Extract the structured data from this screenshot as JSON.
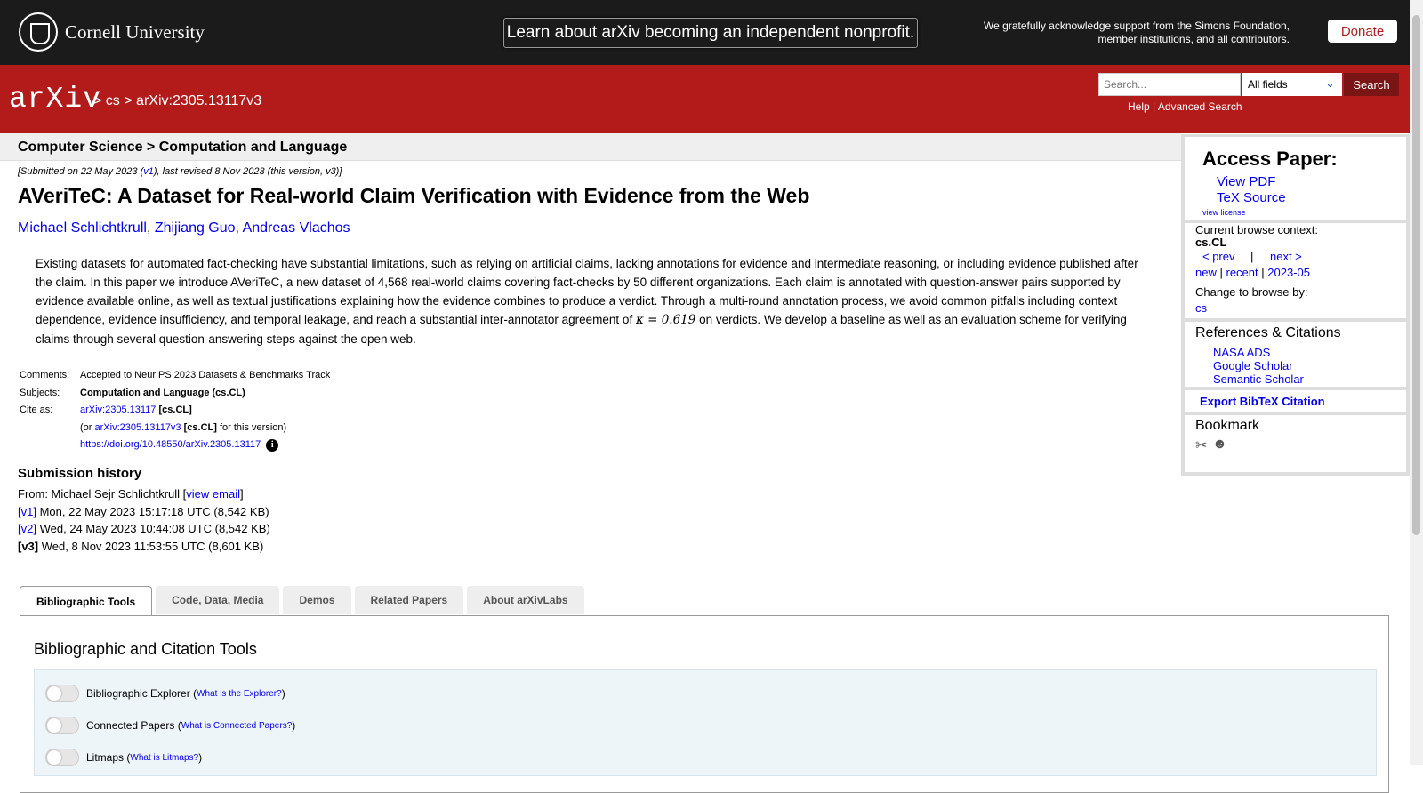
{
  "topbar": {
    "cornell": "Cornell University",
    "banner": "Learn about arXiv becoming an independent nonprofit.",
    "ack_text": "We gratefully acknowledge support from the Simons Foundation,",
    "ack_link1": "member institutions",
    "ack_tail": ", and all contributors.",
    "donate": "Donate"
  },
  "header": {
    "logo": "arXiv",
    "crumb_sep1": ">",
    "crumb_cs": "cs",
    "crumb_sep2": ">",
    "crumb_id": "arXiv:2305.13117v3",
    "search_placeholder": "Search...",
    "field_selected": "All fields",
    "search_button": "Search",
    "help": "Help",
    "sep": "|",
    "advanced": "Advanced Search"
  },
  "main": {
    "subheader": "Computer Science > Computation and Language",
    "date_pre": "[Submitted on 22 May 2023 (",
    "date_v1": "v1",
    "date_post": "), last revised 8 Nov 2023 (this version, v3)]",
    "title": "AVeriTeC: A Dataset for Real-world Claim Verification with Evidence from the Web",
    "authors": [
      "Michael Schlichtkrull",
      "Zhijiang Guo",
      "Andreas Vlachos"
    ],
    "abstract_part1": "Existing datasets for automated fact-checking have substantial limitations, such as relying on artificial claims, lacking annotations for evidence and intermediate reasoning, or including evidence published after the claim. In this paper we introduce AVeriTeC, a new dataset of 4,568 real-world claims covering fact-checks by 50 different organizations. Each claim is annotated with question-answer pairs supported by evidence available online, as well as textual justifications explaining how the evidence combines to produce a verdict. Through a multi-round annotation process, we avoid common pitfalls including context dependence, evidence insufficiency, and temporal leakage, and reach a substantial inter-annotator agreement of ",
    "abstract_math": "κ = 0.619",
    "abstract_part2": " on verdicts. We develop a baseline as well as an evaluation scheme for verifying claims through several question-answering steps against the open web.",
    "comments_label": "Comments:",
    "comments": "Accepted to NeurIPS 2023 Datasets & Benchmarks Track",
    "subjects_label": "Subjects:",
    "subjects": "Computation and Language (cs.CL)",
    "cite_label": "Cite as:",
    "cite_link": "arXiv:2305.13117",
    "cite_cat": "[cs.CL]",
    "cite_or": "(or",
    "cite_version_link": "arXiv:2305.13117v3",
    "cite_version_cat": "[cs.CL]",
    "cite_version_tail": "for this version)",
    "doi": "https://doi.org/10.48550/arXiv.2305.13117",
    "history_title": "Submission history",
    "from_pre": "From: Michael Sejr Schlichtkrull [",
    "from_link": "view email",
    "from_post": "]",
    "versions": [
      {
        "label": "[v1]",
        "text": "Mon, 22 May 2023 15:17:18 UTC (8,542 KB)"
      },
      {
        "label": "[v2]",
        "text": "Wed, 24 May 2023 10:44:08 UTC (8,542 KB)"
      },
      {
        "label": "[v3]",
        "text": "Wed, 8 Nov 2023 11:53:55 UTC (8,601 KB)"
      }
    ]
  },
  "tabs": [
    "Bibliographic Tools",
    "Code, Data, Media",
    "Demos",
    "Related Papers",
    "About arXivLabs"
  ],
  "tools": {
    "title": "Bibliographic and Citation Tools",
    "items": [
      {
        "name": "Bibliographic Explorer",
        "help": "What is the Explorer?"
      },
      {
        "name": "Connected Papers",
        "help": "What is Connected Papers?"
      },
      {
        "name": "Litmaps",
        "help": "What is Litmaps?"
      }
    ]
  },
  "sidebar": {
    "access_title": "Access Paper:",
    "view_pdf": "View PDF",
    "tex_source": "TeX Source",
    "view_license": "view license",
    "context_label": "Current browse context:",
    "context": "cs.CL",
    "prev": "< prev",
    "pipe": "|",
    "next": "next >",
    "new": "new",
    "recent": "recent",
    "month": "2023-05",
    "change_label": "Change to browse by:",
    "change_cs": "cs",
    "refs_title": "References & Citations",
    "nasa": "NASA ADS",
    "google": "Google Scholar",
    "semantic": "Semantic Scholar",
    "export": "Export BibTeX Citation",
    "bookmark": "Bookmark"
  }
}
